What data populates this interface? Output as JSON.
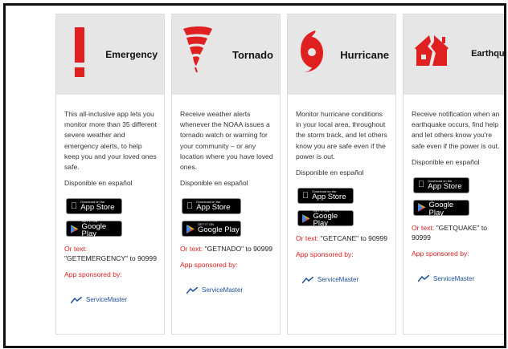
{
  "cards": [
    {
      "title": "Emergency",
      "description": "This all-inclusive app lets you monitor more than 35 different severe weather and emergency alerts, to help keep you and your loved ones safe.",
      "spanish": "Disponible en español",
      "app_store_small": "Download on the",
      "app_store": "App Store",
      "google_small": "GET IT ON",
      "google_play": "Google Play",
      "text_label": "Or text:",
      "text_value": "\"GETEMERGENCY\" to 90999",
      "sponsor": "App sponsored by:",
      "sponsor_name": "ServiceMaster"
    },
    {
      "title": "Tornado",
      "description": "Receive weather alerts whenever the NOAA issues a tornado watch or warning for your community – or any location where you have loved ones.",
      "spanish": "Disponible en español",
      "app_store_small": "Download on the",
      "app_store": "App Store",
      "google_small": "GET IT ON",
      "google_play": "Google Play",
      "text_label": "Or text:",
      "text_value": "\"GETNADO\" to 90999",
      "sponsor": "App sponsored by:",
      "sponsor_name": "ServiceMaster"
    },
    {
      "title": "Hurricane",
      "description": "Monitor hurricane conditions in your local area, throughout the storm track, and let others know you are safe even if the power is out.",
      "spanish": "Disponible en español",
      "app_store_small": "Download on the",
      "app_store": "App Store",
      "google_small": "GET IT ON",
      "google_play": "Google Play",
      "text_label": "Or text:",
      "text_value": "\"GETCANE\" to 90999",
      "sponsor": "App sponsored by:",
      "sponsor_name": "ServiceMaster"
    },
    {
      "title": "Earthquake",
      "description": "Receive notification when an earthquake occurs, find help and let others know you're safe even if the power is out.",
      "spanish": "Disponible en español",
      "app_store_small": "Download on the",
      "app_store": "App Store",
      "google_small": "GET IT ON",
      "google_play": "Google Play",
      "text_label": "Or text:",
      "text_value": "\"GETQUAKE\" to 90999",
      "sponsor": "App sponsored by:",
      "sponsor_name": "ServiceMaster"
    }
  ],
  "colors": {
    "accent_red": "#e02020",
    "header_gray": "#e6e6e6",
    "brand_blue": "#1c4f9c"
  },
  "icons": [
    "exclamation-icon",
    "tornado-icon",
    "hurricane-icon",
    "earthquake-house-icon",
    "apple-icon",
    "google-play-icon",
    "servicemaster-logo-icon"
  ]
}
